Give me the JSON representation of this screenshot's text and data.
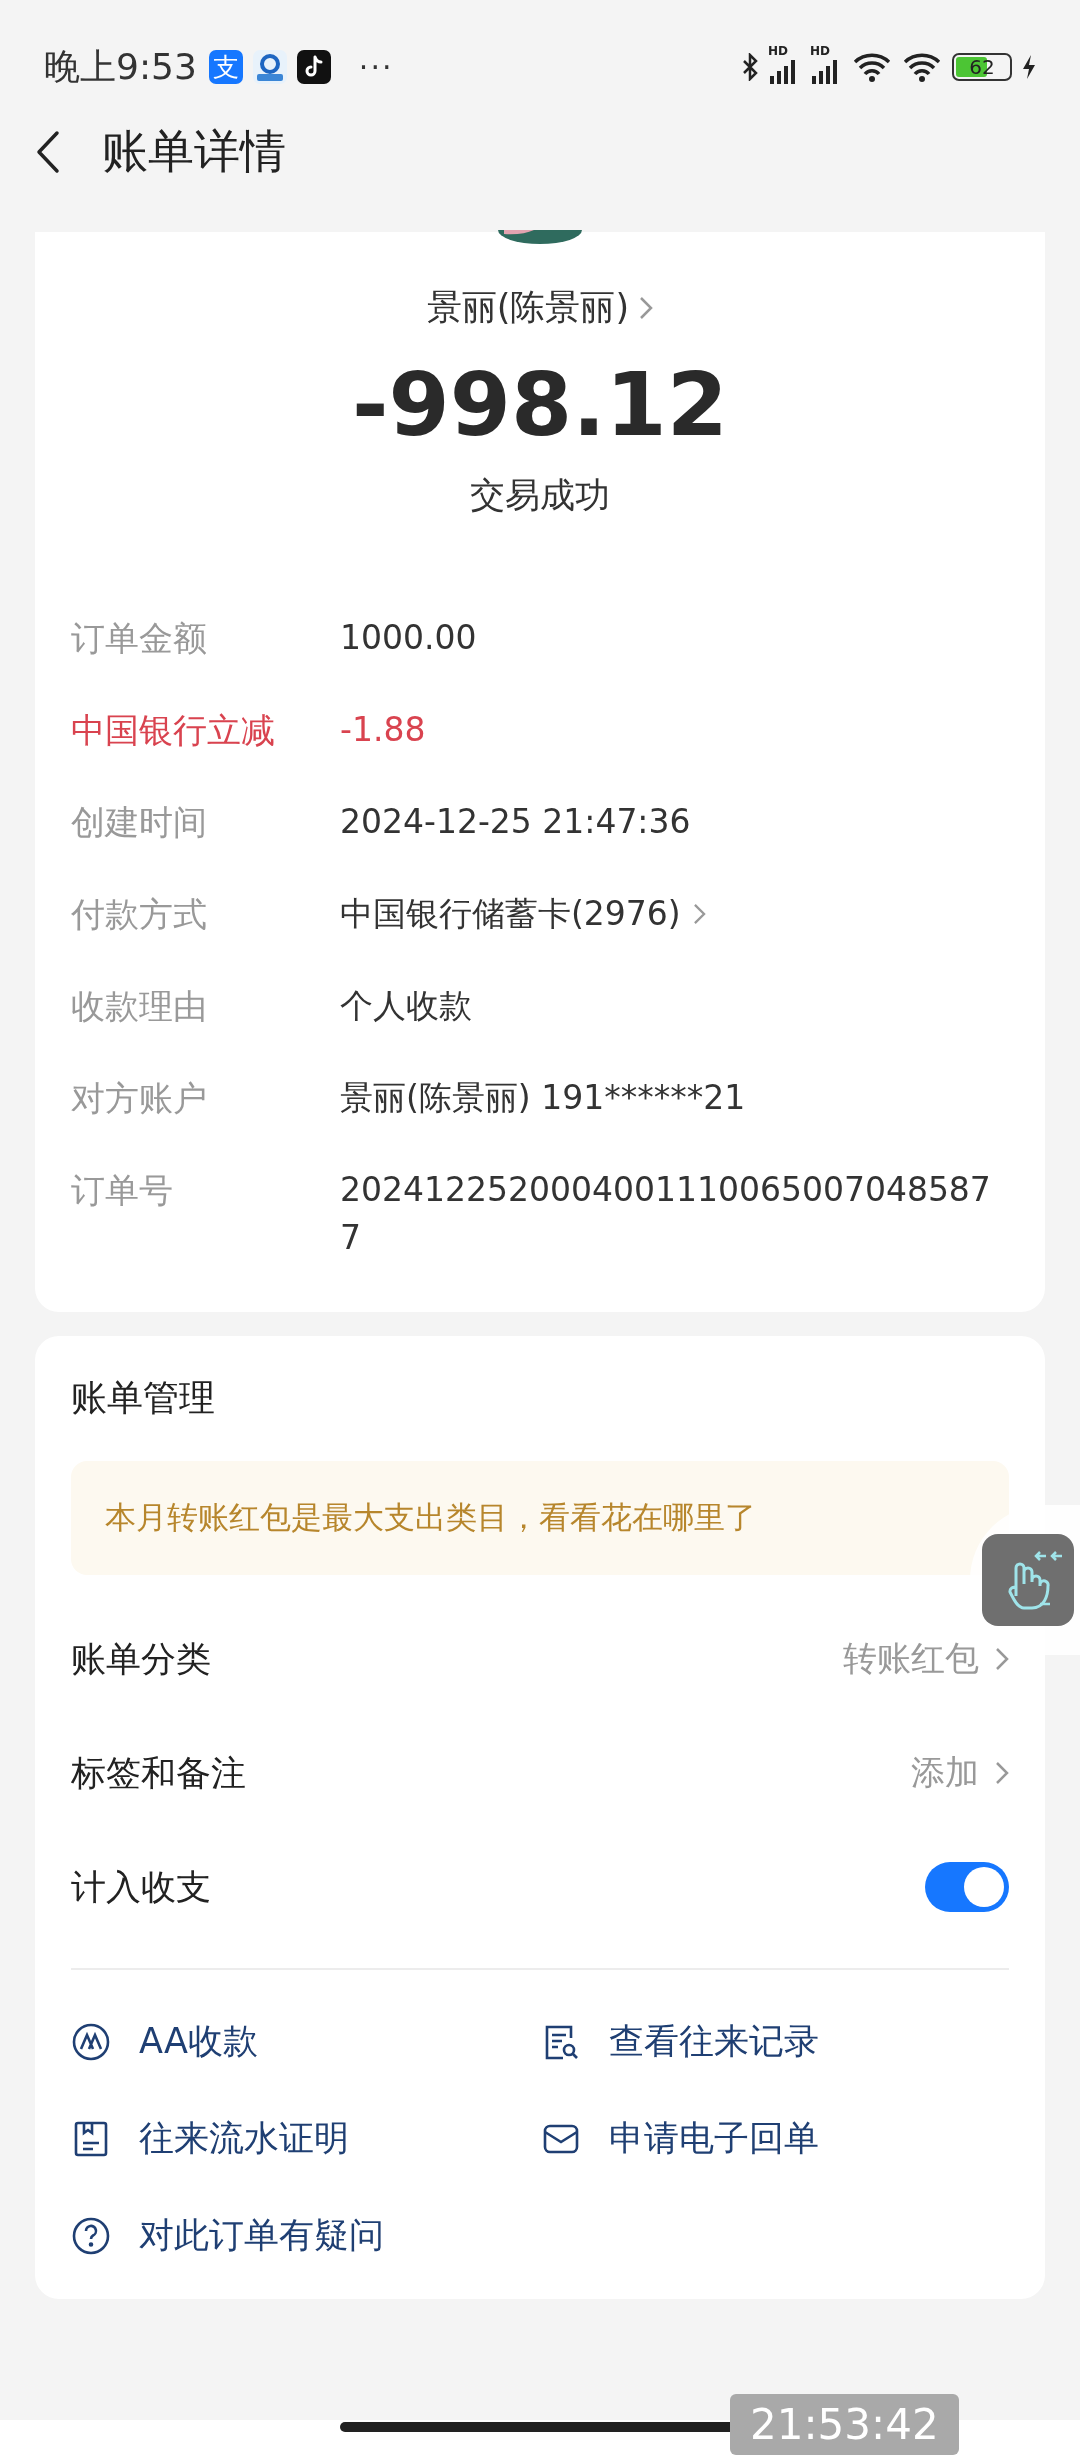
{
  "status_bar": {
    "time": "晚上9:53",
    "alipay_glyph": "支",
    "more": "···",
    "signal_labels": [
      "HD",
      "HD"
    ],
    "battery": "62"
  },
  "header": {
    "title": "账单详情"
  },
  "summary": {
    "payee": "景丽(陈景丽)",
    "amount": "-998.12",
    "status": "交易成功"
  },
  "details": [
    {
      "label": "订单金额",
      "value": "1000.00",
      "highlight": false,
      "chevron": false
    },
    {
      "label": "中国银行立减",
      "value": "-1.88",
      "highlight": true,
      "chevron": false
    },
    {
      "label": "创建时间",
      "value": "2024-12-25 21:47:36",
      "highlight": false,
      "chevron": false
    },
    {
      "label": "付款方式",
      "value": "中国银行储蓄卡(2976)",
      "highlight": false,
      "chevron": true
    },
    {
      "label": "收款理由",
      "value": "个人收款",
      "highlight": false,
      "chevron": false
    },
    {
      "label": "对方账户",
      "value": "景丽(陈景丽) 191******21",
      "highlight": false,
      "chevron": false
    },
    {
      "label": "订单号",
      "value": "20241225200040011100650070485877",
      "highlight": false,
      "chevron": false
    }
  ],
  "management": {
    "title": "账单管理",
    "banner": "本月转账红包是最大支出类目，看看花在哪里了",
    "rows": [
      {
        "kind": "link",
        "label": "账单分类",
        "value": "转账红包"
      },
      {
        "kind": "link",
        "label": "标签和备注",
        "value": "添加"
      },
      {
        "kind": "toggle",
        "label": "计入收支",
        "on": true
      }
    ],
    "actions": [
      {
        "kind": "aa",
        "label": "AA收款"
      },
      {
        "kind": "records",
        "label": "查看往来记录"
      },
      {
        "kind": "statement",
        "label": "往来流水证明"
      },
      {
        "kind": "mail",
        "label": "申请电子回单"
      },
      {
        "kind": "question",
        "label": "对此订单有疑问"
      }
    ]
  },
  "overlay_time": "21:53:42"
}
